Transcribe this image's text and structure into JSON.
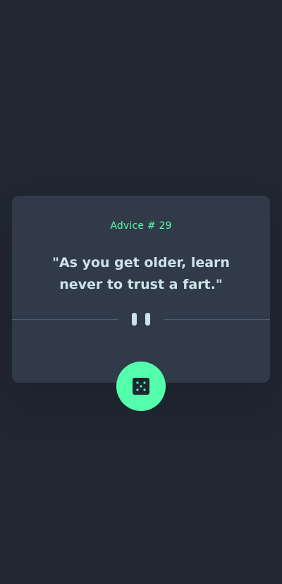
{
  "card": {
    "advice_id": "Advice # 29",
    "quote": "\"As you get older, learn never to trust a fart.\""
  },
  "icons": {
    "divider": "pause-icon",
    "action": "dice-icon"
  },
  "colors": {
    "page_bg": "#202632",
    "card_bg": "#313A49",
    "accent": "#53FFAA",
    "text": "#CEE3E9",
    "divider": "#4F5D74"
  }
}
